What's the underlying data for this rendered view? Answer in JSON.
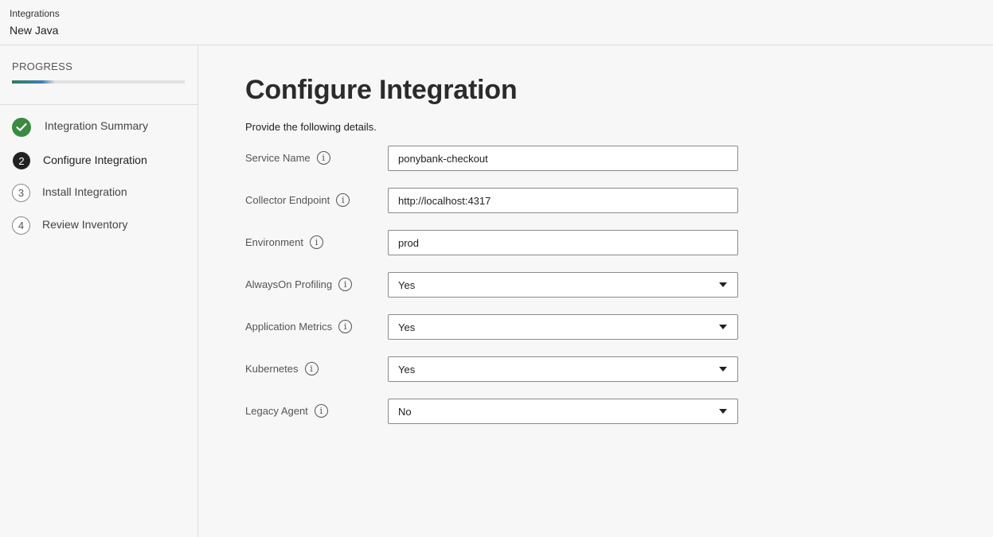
{
  "header": {
    "breadcrumb": "Integrations",
    "title": "New Java"
  },
  "sidebar": {
    "progress_label": "PROGRESS",
    "progress_fraction": 0.25,
    "steps": [
      {
        "label": "Integration Summary",
        "status": "done",
        "number": ""
      },
      {
        "label": "Configure Integration",
        "status": "current",
        "number": "2"
      },
      {
        "label": "Install Integration",
        "status": "todo",
        "number": "3"
      },
      {
        "label": "Review Inventory",
        "status": "todo",
        "number": "4"
      }
    ]
  },
  "main": {
    "title": "Configure Integration",
    "subtitle": "Provide the following details.",
    "fields": {
      "service_name": {
        "label": "Service Name",
        "value": "ponybank-checkout"
      },
      "collector_endpoint": {
        "label": "Collector Endpoint",
        "value": "http://localhost:4317"
      },
      "environment": {
        "label": "Environment",
        "value": "prod"
      },
      "alwayson_profiling": {
        "label": "AlwaysOn Profiling",
        "value": "Yes"
      },
      "application_metrics": {
        "label": "Application Metrics",
        "value": "Yes"
      },
      "kubernetes": {
        "label": "Kubernetes",
        "value": "Yes"
      },
      "legacy_agent": {
        "label": "Legacy Agent",
        "value": "No"
      }
    }
  },
  "icons": {
    "info": "info-icon",
    "check": "checkmark-icon",
    "dropdown": "chevron-down-icon"
  },
  "colors": {
    "done": "#3a8a3f",
    "current": "#222222",
    "progress_start": "#2f7d5a",
    "progress_end": "#3d7fb5"
  }
}
